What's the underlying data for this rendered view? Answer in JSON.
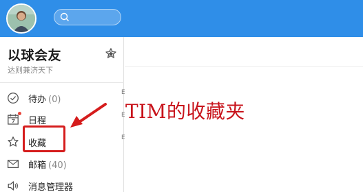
{
  "header": {
    "avatar_icon": "user-avatar",
    "search_icon": "search-icon",
    "brand_color": "#2f8ee8"
  },
  "group": {
    "title": "以球会友",
    "subtitle": "达则兼济天下",
    "star_icon": "star-icon"
  },
  "nav": {
    "items": [
      {
        "label": "待办",
        "count": "(0)",
        "icon": "check-circle-icon"
      },
      {
        "label": "日程",
        "count": "",
        "icon": "calendar-icon",
        "badge": "red-dot"
      },
      {
        "label": "收藏",
        "count": "",
        "icon": "star-icon"
      },
      {
        "label": "邮箱",
        "count": "(40)",
        "icon": "mail-icon"
      },
      {
        "label": "消息管理器",
        "count": "",
        "icon": "speaker-icon"
      }
    ]
  },
  "main": {
    "fragments": [
      "E",
      "E",
      "E"
    ]
  },
  "annotation": {
    "text": "TIM的收藏夹",
    "color": "#c8141c"
  }
}
